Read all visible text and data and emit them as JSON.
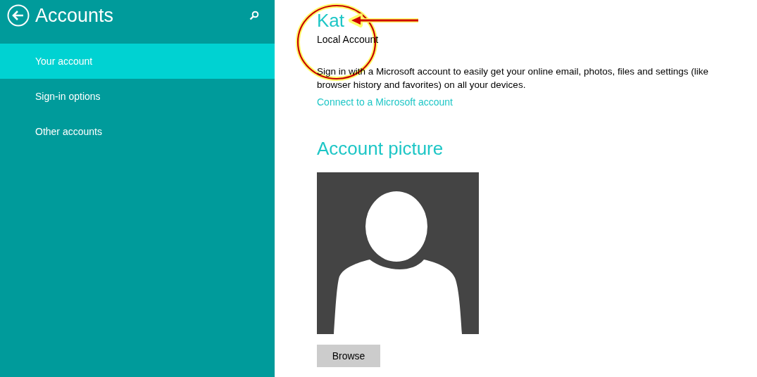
{
  "sidebar": {
    "title": "Accounts",
    "items": [
      {
        "label": "Your account",
        "selected": true
      },
      {
        "label": "Sign-in options",
        "selected": false
      },
      {
        "label": "Other accounts",
        "selected": false
      }
    ]
  },
  "account": {
    "name": "Kat",
    "type": "Local Account",
    "description": "Sign in with a Microsoft account to easily get your online email, photos, files and settings (like browser history and favorites) on all your devices.",
    "link": "Connect to a Microsoft account"
  },
  "picture_section": {
    "heading": "Account picture",
    "button": "Browse"
  },
  "annotations": [
    {
      "kind": "circle"
    },
    {
      "kind": "arrow"
    }
  ]
}
